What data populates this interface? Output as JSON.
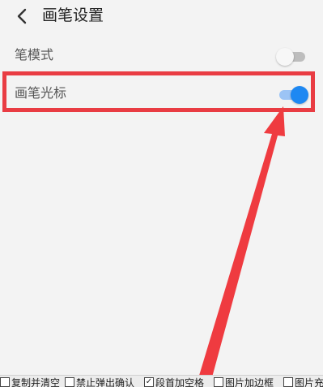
{
  "header": {
    "title": "画笔设置",
    "back_icon": "chevron-left-icon"
  },
  "settings": [
    {
      "label": "笔模式",
      "toggle": "off"
    },
    {
      "label": "画笔光标",
      "toggle": "on"
    }
  ],
  "colors": {
    "highlight": "#e93c43",
    "toggle_on": "#1e88f2",
    "toggle_track_on": "#9cc4f5",
    "toggle_off_track": "#bdbdbd",
    "background": "#f3f3f3"
  },
  "bottom_options": [
    {
      "label": "复制并清空",
      "checked": false
    },
    {
      "label": "禁止弹出确认",
      "checked": false
    },
    {
      "label": "段首加空格",
      "checked": true
    },
    {
      "label": "图片加边框",
      "checked": false
    },
    {
      "label": "图片充",
      "checked": false
    }
  ]
}
